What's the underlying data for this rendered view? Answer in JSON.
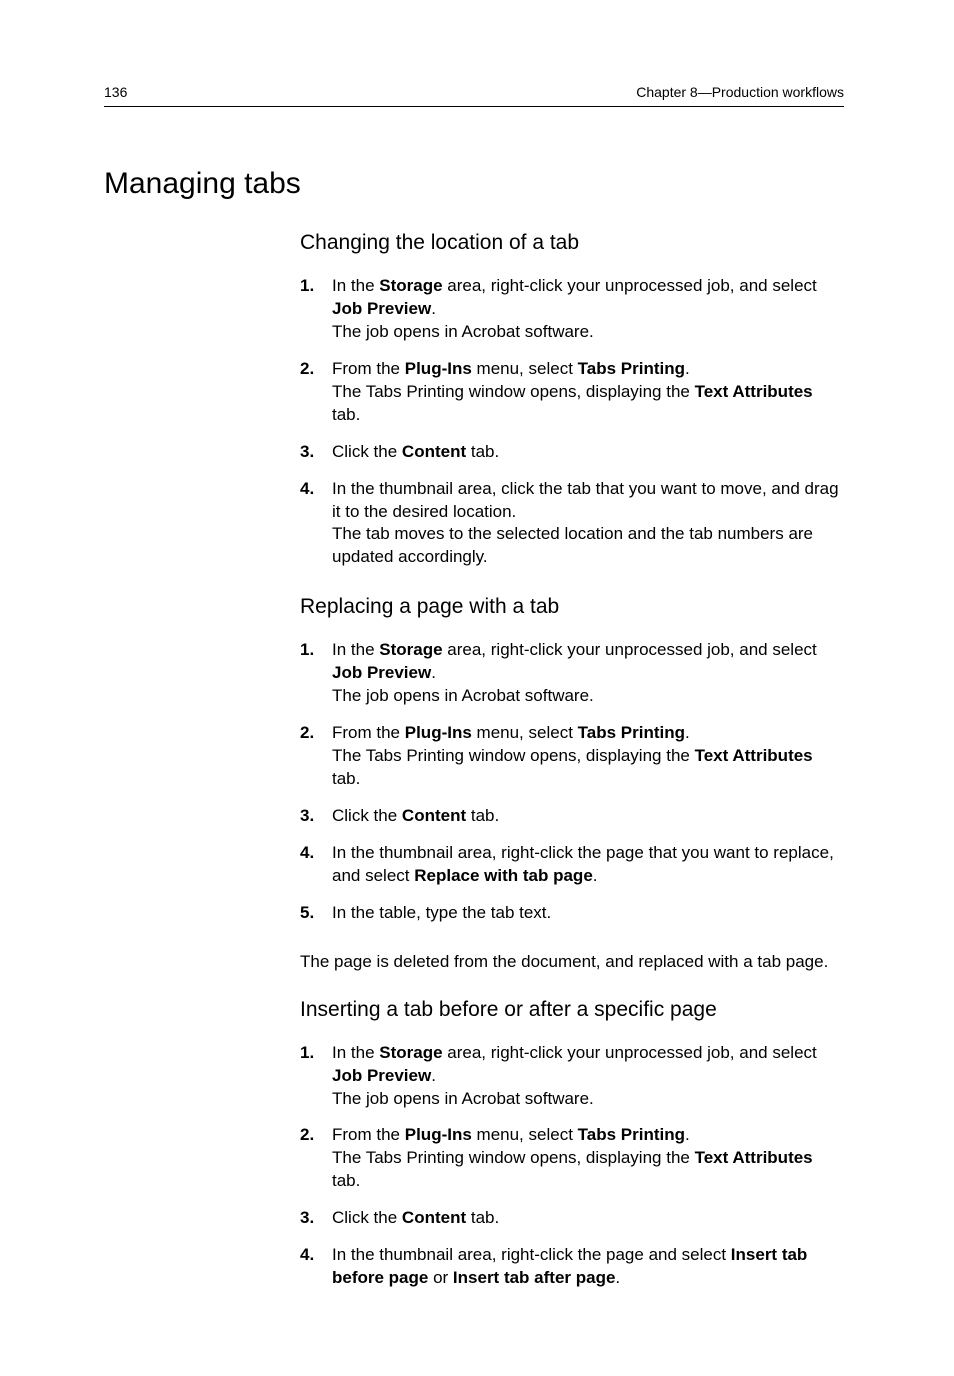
{
  "header": {
    "pageNumber": "136",
    "chapterLabel": "Chapter 8—Production workflows"
  },
  "title": "Managing tabs",
  "sections": [
    {
      "heading": "Changing the location of a tab",
      "steps": [
        {
          "num": "1.",
          "parts": [
            "In the ",
            "Storage",
            " area, right-click your unprocessed job, and select ",
            "Job Preview",
            "."
          ],
          "result": "The job opens in Acrobat software."
        },
        {
          "num": "2.",
          "parts": [
            "From the ",
            "Plug-Ins",
            " menu, select ",
            "Tabs Printing",
            "."
          ],
          "resultParts": [
            "The Tabs Printing window opens, displaying the ",
            "Text Attributes",
            " tab."
          ]
        },
        {
          "num": "3.",
          "parts": [
            "Click the ",
            "Content",
            " tab."
          ]
        },
        {
          "num": "4.",
          "plain": "In the thumbnail area, click the tab that you want to move, and drag it to the desired location.",
          "result": "The tab moves to the selected location and the tab numbers are updated accordingly."
        }
      ]
    },
    {
      "heading": "Replacing a page with a tab",
      "steps": [
        {
          "num": "1.",
          "parts": [
            "In the ",
            "Storage",
            " area, right-click your unprocessed job, and select ",
            "Job Preview",
            "."
          ],
          "result": "The job opens in Acrobat software."
        },
        {
          "num": "2.",
          "parts": [
            "From the ",
            "Plug-Ins",
            " menu, select ",
            "Tabs Printing",
            "."
          ],
          "resultParts": [
            "The Tabs Printing window opens, displaying the ",
            "Text Attributes",
            " tab."
          ]
        },
        {
          "num": "3.",
          "parts": [
            "Click the ",
            "Content",
            " tab."
          ]
        },
        {
          "num": "4.",
          "parts": [
            "In the thumbnail area, right-click the page that you want to replace, and select ",
            "Replace with tab page",
            "."
          ]
        },
        {
          "num": "5.",
          "plain": "In the table, type the tab text."
        }
      ],
      "trailing": "The page is deleted from the document, and replaced with a tab page."
    },
    {
      "heading": "Inserting a tab before or after a specific page",
      "steps": [
        {
          "num": "1.",
          "parts": [
            "In the ",
            "Storage",
            " area, right-click your unprocessed job, and select ",
            "Job Preview",
            "."
          ],
          "result": "The job opens in Acrobat software."
        },
        {
          "num": "2.",
          "parts": [
            "From the ",
            "Plug-Ins",
            " menu, select ",
            "Tabs Printing",
            "."
          ],
          "resultParts": [
            "The Tabs Printing window opens, displaying the ",
            "Text Attributes",
            " tab."
          ]
        },
        {
          "num": "3.",
          "parts": [
            "Click the ",
            "Content",
            " tab."
          ]
        },
        {
          "num": "4.",
          "parts": [
            "In the thumbnail area, right-click the page and select ",
            "Insert tab before page",
            " or ",
            "Insert tab after page",
            "."
          ]
        }
      ]
    }
  ]
}
